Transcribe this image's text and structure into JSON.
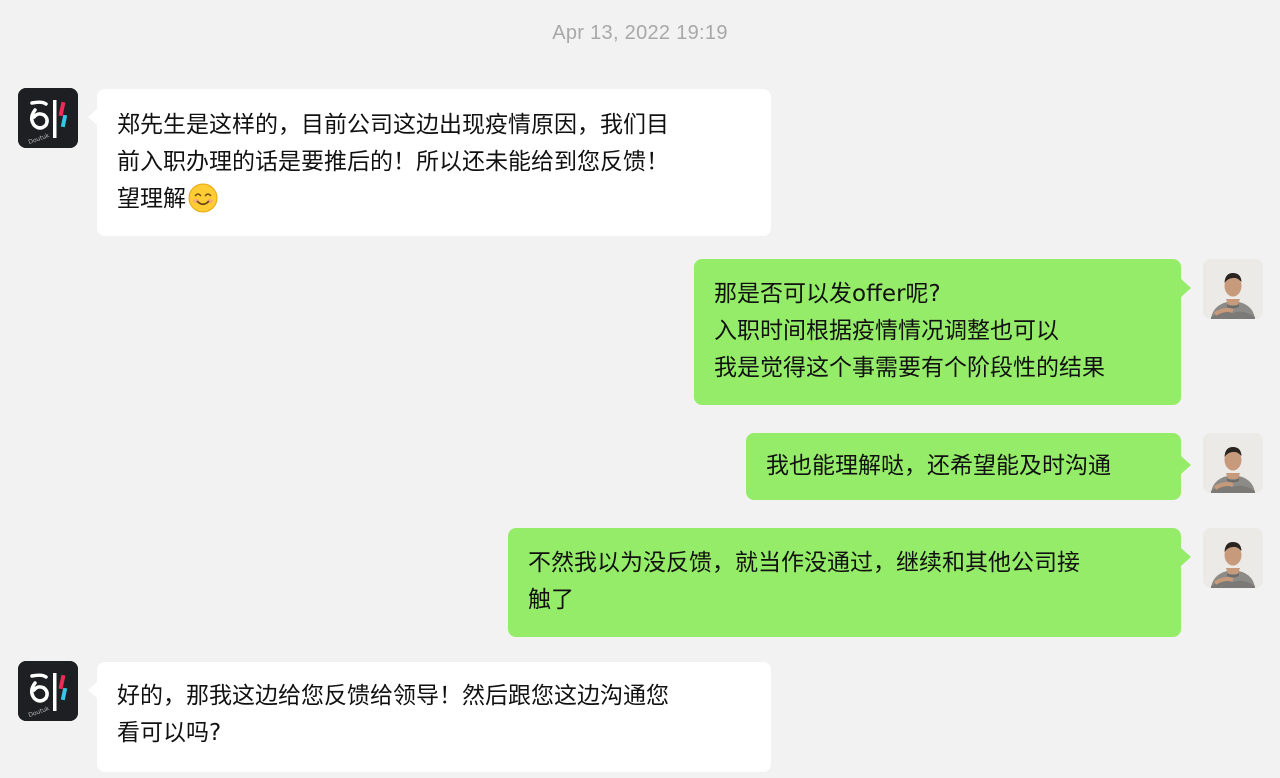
{
  "chat": {
    "timestamp": "Apr 13, 2022 19:19",
    "messages": [
      {
        "sender": "company",
        "avatar_icon": "doutuk-logo-icon",
        "lines": [
          "郑先生是这样的，目前公司这边出现疫情原因，我们目",
          "前入职办理的话是要推后的！所以还未能给到您反馈！",
          "望理解"
        ],
        "emoji": "smiling-face-icon"
      },
      {
        "sender": "user",
        "avatar_icon": "user-photo-icon",
        "lines": [
          "那是否可以发offer呢?",
          "入职时间根据疫情情况调整也可以",
          "我是觉得这个事需要有个阶段性的结果"
        ]
      },
      {
        "sender": "user",
        "avatar_icon": "user-photo-icon",
        "lines": [
          "我也能理解哒，还希望能及时沟通"
        ]
      },
      {
        "sender": "user",
        "avatar_icon": "user-photo-icon",
        "lines": [
          "不然我以为没反馈，就当作没通过，继续和其他公司接",
          "触了"
        ]
      },
      {
        "sender": "company",
        "avatar_icon": "doutuk-logo-icon",
        "lines": [
          "好的，那我这边给您反馈给领导！然后跟您这边沟通您",
          "看可以吗?"
        ]
      }
    ]
  },
  "colors": {
    "background": "#f2f2f2",
    "incoming_bubble": "#ffffff",
    "outgoing_bubble": "#95ec69",
    "timestamp_text": "#a8a8a8"
  }
}
